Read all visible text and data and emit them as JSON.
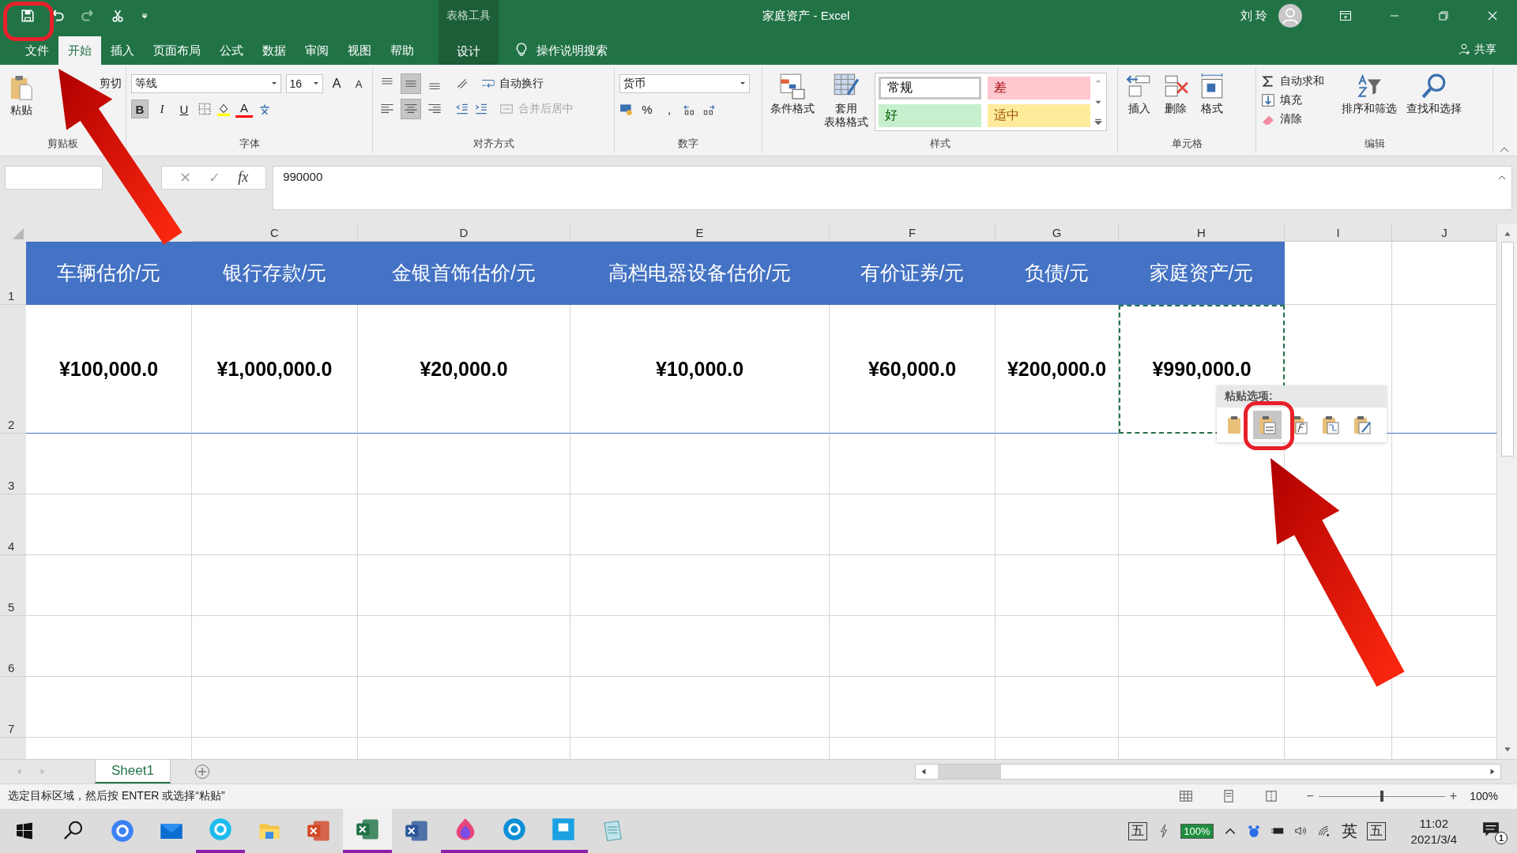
{
  "title_bar": {
    "contextual_label": "表格工具",
    "title": "家庭资产  -  Excel",
    "user": "刘 玲"
  },
  "ribbon_tabs": [
    {
      "label": "文件",
      "selected": false
    },
    {
      "label": "开始",
      "selected": true
    },
    {
      "label": "插入",
      "selected": false
    },
    {
      "label": "页面布局",
      "selected": false
    },
    {
      "label": "公式",
      "selected": false
    },
    {
      "label": "数据",
      "selected": false
    },
    {
      "label": "审阅",
      "selected": false
    },
    {
      "label": "视图",
      "selected": false
    },
    {
      "label": "帮助",
      "selected": false
    }
  ],
  "contextual_tab": {
    "label": "设计"
  },
  "tell_me": {
    "placeholder": "操作说明搜索"
  },
  "share": "共享",
  "ribbon": {
    "clipboard": {
      "label": "剪贴板",
      "paste": "粘贴",
      "cut": "剪切"
    },
    "font": {
      "label": "字体",
      "name": "等线",
      "size": "16",
      "grow": "A",
      "shrink": "A",
      "bold": "B",
      "italic": "I",
      "underline": "U",
      "font_color": "A",
      "bold_on": true
    },
    "alignment": {
      "label": "对齐方式",
      "vertical": [
        {
          "selected": false
        },
        {
          "selected": true
        },
        {
          "selected": false
        }
      ],
      "horizontal": [
        {
          "selected": false
        },
        {
          "selected": true
        },
        {
          "selected": false
        }
      ],
      "wrap": "自动换行",
      "merge": {
        "label": "合并后居中",
        "disabled": true
      }
    },
    "number": {
      "label": "数字",
      "format": "货币",
      "percent": "%",
      "comma": ","
    },
    "styles": {
      "label": "样式",
      "conditional": "条件格式",
      "table_line1": "套用",
      "table_line2": "表格格式",
      "gallery": [
        {
          "label": "常规",
          "kind": "normal",
          "color": "#ffffff"
        },
        {
          "label": "差",
          "kind": "bad",
          "color": "#ffc7ce"
        },
        {
          "label": "好",
          "kind": "good",
          "color": "#c6efce"
        },
        {
          "label": "适中",
          "kind": "neutral",
          "color": "#ffeb9c"
        }
      ]
    },
    "cells": {
      "label": "单元格",
      "insert": "插入",
      "delete": "删除",
      "format": "格式"
    },
    "editing": {
      "label": "编辑",
      "autosum": "自动求和",
      "fill": "填充",
      "clear": "清除",
      "sort": "排序和筛选",
      "find": "查找和选择"
    }
  },
  "formula_bar": {
    "cancel": "✕",
    "enter": "✓",
    "fx": "fx",
    "value": "990000"
  },
  "sheet": {
    "columns": [
      "C",
      "D",
      "E",
      "F",
      "G",
      "H",
      "I",
      "J"
    ],
    "rows": [
      "1",
      "2",
      "3",
      "4",
      "5",
      "6",
      "7"
    ],
    "headers": [
      "车辆估价/元",
      "银行存款/元",
      "金银首饰估价/元",
      "高档电器设备估价/元",
      "有价证券/元",
      "负债/元",
      "家庭资产/元"
    ],
    "values": [
      {
        "text": "¥100,000.0",
        "marquee": false
      },
      {
        "text": "¥1,000,000.0",
        "marquee": false
      },
      {
        "text": "¥20,000.0",
        "marquee": false
      },
      {
        "text": "¥10,000.0",
        "marquee": false
      },
      {
        "text": "¥60,000.0",
        "marquee": false
      },
      {
        "text": "¥200,000.0",
        "marquee": false
      },
      {
        "text": "¥990,000.0",
        "marquee": true
      }
    ]
  },
  "paste_options": {
    "title": "粘贴选项:",
    "items": [
      {
        "kind": "paste",
        "selected": false
      },
      {
        "kind": "values",
        "selected": true
      },
      {
        "kind": "formulas",
        "selected": false
      },
      {
        "kind": "transpose",
        "selected": false
      },
      {
        "kind": "formatting",
        "selected": false
      }
    ]
  },
  "sheet_tabs": [
    {
      "label": "Sheet1",
      "selected": true
    }
  ],
  "status_bar": {
    "message": "选定目标区域，然后按 ENTER 或选择“粘贴”",
    "zoom_out": "−",
    "zoom_in": "+",
    "level": 0.5,
    "zoom": "100%"
  },
  "taskbar": {
    "apps": [
      {
        "kind": "search",
        "running": false,
        "active": false
      },
      {
        "kind": "lens",
        "running": false,
        "active": false
      },
      {
        "kind": "mail",
        "running": false,
        "active": false
      },
      {
        "kind": "ie",
        "running": true,
        "active": false
      },
      {
        "kind": "folder",
        "running": false,
        "active": false
      },
      {
        "kind": "powerpoint",
        "running": false,
        "active": false
      },
      {
        "kind": "excel",
        "running": true,
        "active": true
      },
      {
        "kind": "word",
        "running": false,
        "active": false
      },
      {
        "kind": "paint",
        "running": true,
        "active": false
      },
      {
        "kind": "edge",
        "running": true,
        "active": false
      },
      {
        "kind": "app",
        "running": true,
        "active": false
      },
      {
        "kind": "notepad",
        "running": false,
        "active": false
      }
    ],
    "ime": "五",
    "battery": "100%",
    "lang": "英",
    "ime2": "五",
    "time": "11:02",
    "date": "2021/3/4",
    "notifications": "1"
  }
}
